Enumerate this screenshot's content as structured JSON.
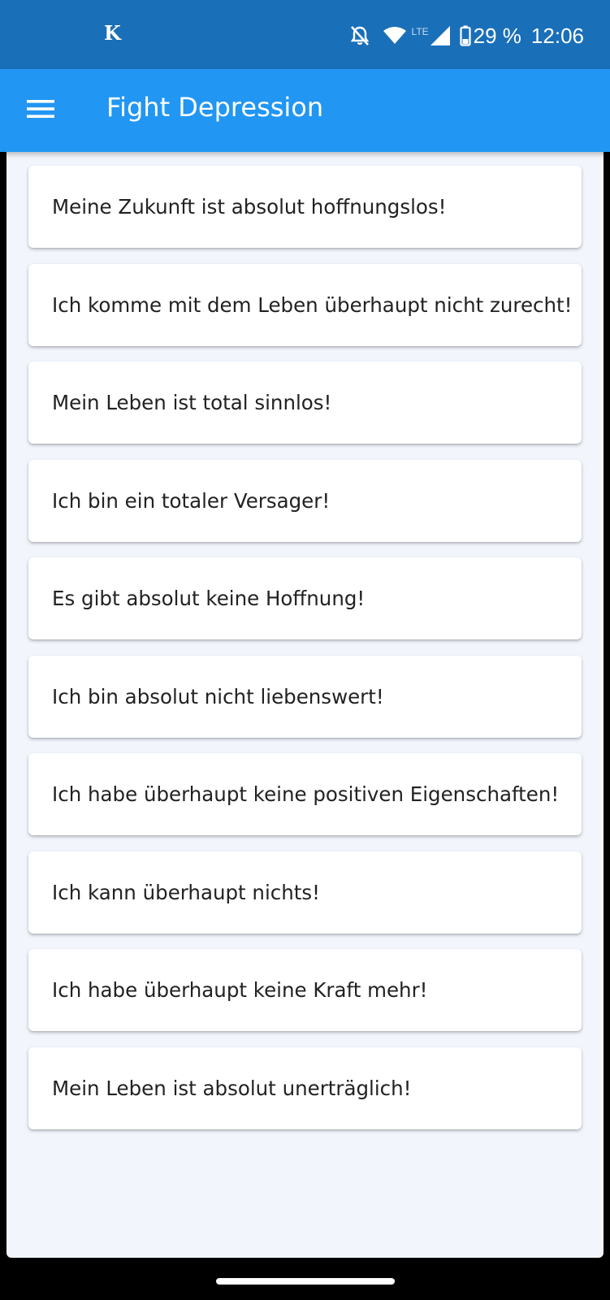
{
  "status_bar": {
    "left_icon": "K",
    "icons": [
      "notifications-off-icon",
      "wifi-icon",
      "lte-icon",
      "signal-icon",
      "battery-icon"
    ],
    "network_label": "LTE",
    "battery": "29 %",
    "time": "12:06"
  },
  "app_bar": {
    "menu_icon": "hamburger-menu-icon",
    "title": "Fight Depression",
    "color": "#2196f3",
    "status_color": "#1a6fb9"
  },
  "thoughts": [
    "Meine Zukunft ist absolut hoffnungslos!",
    "Ich komme mit dem Leben überhaupt nicht zurecht!",
    "Mein Leben ist total sinnlos!",
    "Ich bin ein totaler Versager!",
    "Es gibt absolut keine Hoffnung!",
    "Ich bin absolut nicht liebenswert!",
    "Ich habe überhaupt keine positiven Eigenschaften!",
    "Ich kann überhaupt nichts!",
    "Ich habe überhaupt keine Kraft mehr!",
    "Mein Leben ist absolut unerträglich!"
  ]
}
